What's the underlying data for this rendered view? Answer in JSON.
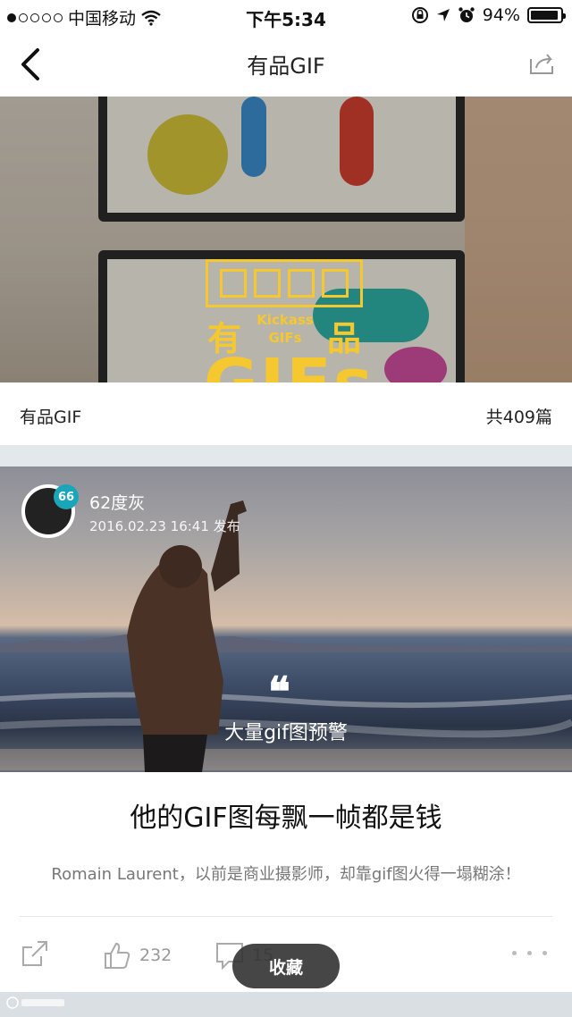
{
  "status_bar": {
    "carrier": "中国移动",
    "time": "下午5:34",
    "battery": "94%",
    "battery_level": 0.94,
    "signal_bars_filled": 1,
    "signal_bars_total": 5
  },
  "nav": {
    "title": "有品GIF"
  },
  "banner": {
    "logo_cn_left": "有",
    "logo_cn_right": "品",
    "logo_en_small_1": "Kickass",
    "logo_en_small_2": "GIFs",
    "logo_big": "GIFs"
  },
  "section": {
    "name": "有品GIF",
    "count": "共409篇"
  },
  "article": {
    "author": "62度灰",
    "avatar_badge": "66",
    "published": "2016.02.23 16:41 发布",
    "quote_mark": "❝",
    "quote_text": "大量gif图预警",
    "title": "他的GIF图每飘一帧都是钱",
    "summary": "Romain Laurent，以前是商业摄影师，却靠gif图火得一塌糊涂！"
  },
  "actions": {
    "likes": "232",
    "comments": "15",
    "toast": "收藏"
  },
  "colors": {
    "logo_yellow": "#f5c830",
    "badge_teal": "#1aa6b8",
    "divider": "#e3e8ea"
  },
  "icons": {
    "back": "chevron-left-icon",
    "share": "share-icon",
    "like": "thumbs-up-icon",
    "comment": "comment-icon",
    "more": "more-icon"
  }
}
